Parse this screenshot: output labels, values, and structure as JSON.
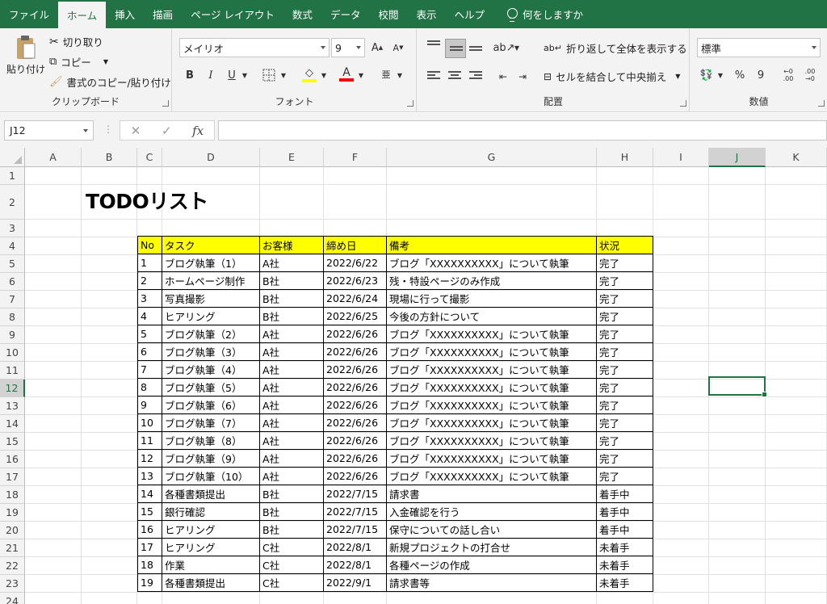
{
  "ribbon_tabs": [
    "ファイル",
    "ホーム",
    "挿入",
    "描画",
    "ページ レイアウト",
    "数式",
    "データ",
    "校閲",
    "表示",
    "ヘルプ"
  ],
  "active_tab": "ホーム",
  "tell_me": "何をしますか",
  "clipboard": {
    "paste": "貼り付け",
    "cut": "切り取り",
    "copy": "コピー",
    "format_painter": "書式のコピー/貼り付け",
    "label": "クリップボード"
  },
  "font": {
    "name": "メイリオ",
    "size": "9",
    "grow_icon": "A",
    "shrink_icon": "A",
    "bold": "B",
    "italic": "I",
    "underline": "U",
    "font_color_icon": "A",
    "phonetic_icon": "亜",
    "fill_color": "#ffff00",
    "font_color": "#ff0000",
    "label": "フォント"
  },
  "alignment": {
    "wrap_text": "折り返して全体を表示する",
    "merge_center": "セルを結合して中央揃え",
    "label": "配置"
  },
  "number": {
    "format": "標準",
    "percent": "%",
    "comma": "9",
    "increase_decimal": ".00",
    "decrease_decimal": ".00",
    "label": "数値"
  },
  "formula_bar": {
    "name_box": "J12",
    "cancel": "✕",
    "enter": "✓",
    "fx": "fx",
    "value": ""
  },
  "columns": [
    "A",
    "B",
    "C",
    "D",
    "E",
    "F",
    "G",
    "H",
    "I",
    "J",
    "K"
  ],
  "selected_column": "J",
  "rows": [
    "1",
    "2",
    "3",
    "4",
    "5",
    "6",
    "7",
    "8",
    "9",
    "10",
    "11",
    "12",
    "13",
    "14",
    "15",
    "16",
    "17",
    "18",
    "19",
    "20",
    "21",
    "22",
    "23",
    "24"
  ],
  "selected_row": "12",
  "sheet_title": "TODOリスト",
  "table": {
    "headers": [
      "No",
      "タスク",
      "お客様",
      "締め日",
      "備考",
      "状況"
    ],
    "rows": [
      [
        "1",
        "ブログ執筆（1）",
        "A社",
        "2022/6/22",
        "ブログ「XXXXXXXXXX」について執筆",
        "完了"
      ],
      [
        "2",
        "ホームページ制作",
        "B社",
        "2022/6/23",
        "残・特設ページのみ作成",
        "完了"
      ],
      [
        "3",
        "写真撮影",
        "B社",
        "2022/6/24",
        "現場に行って撮影",
        "完了"
      ],
      [
        "4",
        "ヒアリング",
        "B社",
        "2022/6/25",
        "今後の方針について",
        "完了"
      ],
      [
        "5",
        "ブログ執筆（2）",
        "A社",
        "2022/6/26",
        "ブログ「XXXXXXXXXX」について執筆",
        "完了"
      ],
      [
        "6",
        "ブログ執筆（3）",
        "A社",
        "2022/6/26",
        "ブログ「XXXXXXXXXX」について執筆",
        "完了"
      ],
      [
        "7",
        "ブログ執筆（4）",
        "A社",
        "2022/6/26",
        "ブログ「XXXXXXXXXX」について執筆",
        "完了"
      ],
      [
        "8",
        "ブログ執筆（5）",
        "A社",
        "2022/6/26",
        "ブログ「XXXXXXXXXX」について執筆",
        "完了"
      ],
      [
        "9",
        "ブログ執筆（6）",
        "A社",
        "2022/6/26",
        "ブログ「XXXXXXXXXX」について執筆",
        "完了"
      ],
      [
        "10",
        "ブログ執筆（7）",
        "A社",
        "2022/6/26",
        "ブログ「XXXXXXXXXX」について執筆",
        "完了"
      ],
      [
        "11",
        "ブログ執筆（8）",
        "A社",
        "2022/6/26",
        "ブログ「XXXXXXXXXX」について執筆",
        "完了"
      ],
      [
        "12",
        "ブログ執筆（9）",
        "A社",
        "2022/6/26",
        "ブログ「XXXXXXXXXX」について執筆",
        "完了"
      ],
      [
        "13",
        "ブログ執筆（10）",
        "A社",
        "2022/6/26",
        "ブログ「XXXXXXXXXX」について執筆",
        "完了"
      ],
      [
        "14",
        "各種書類提出",
        "B社",
        "2022/7/15",
        "請求書",
        "着手中"
      ],
      [
        "15",
        "銀行確認",
        "B社",
        "2022/7/15",
        "入金確認を行う",
        "着手中"
      ],
      [
        "16",
        "ヒアリング",
        "B社",
        "2022/7/15",
        "保守についての話し合い",
        "着手中"
      ],
      [
        "17",
        "ヒアリング",
        "C社",
        "2022/8/1",
        "新規プロジェクトの打合せ",
        "未着手"
      ],
      [
        "18",
        "作業",
        "C社",
        "2022/8/1",
        "各種ページの作成",
        "未着手"
      ],
      [
        "19",
        "各種書類提出",
        "C社",
        "2022/9/1",
        "請求書等",
        "未着手"
      ]
    ]
  }
}
